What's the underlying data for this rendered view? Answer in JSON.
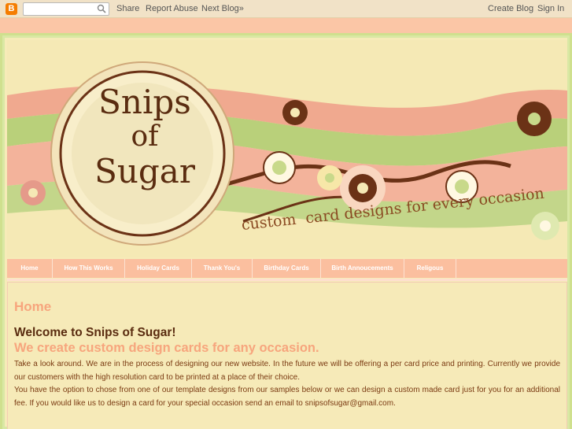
{
  "navbar": {
    "logo_letter": "B",
    "search_placeholder": "",
    "share": "Share",
    "report_abuse": "Report Abuse",
    "next_blog": "Next Blog»",
    "create_blog": "Create Blog",
    "sign_in": "Sign In"
  },
  "header": {
    "logo_line1": "Snips",
    "logo_line2": "of",
    "logo_line3": "Sugar",
    "slogan": "custom  card designs for every occasion"
  },
  "menu": {
    "items": [
      {
        "label": "Home"
      },
      {
        "label": "How This Works"
      },
      {
        "label": "Holiday Cards"
      },
      {
        "label": "Thank You's"
      },
      {
        "label": "Birthday Cards"
      },
      {
        "label": "Birth Annoucements"
      },
      {
        "label": "Religous"
      }
    ]
  },
  "content": {
    "page_title": "Home",
    "welcome": "Welcome to Snips of Sugar!",
    "tagline": "We create custom design cards for any occasion.",
    "paragraph1": "Take a look around. We are in the process of designing our new website. In the future we will be offering a per card price and printing. Currently we provide our customers with the high resolution card to be printed at a place of their choice.",
    "paragraph2": "You have the option to chose from one of our template designs from our samples below or we can design a custom made card just for you for an additional fee. If you would like us to design a card for your special occasion send an email to snipsofsugar@gmail.com."
  },
  "colors": {
    "navbar_bg": "#f1e2c7",
    "accent_peach": "#fbbf9f",
    "title_peach": "#f7a57d",
    "brown": "#5a2c10",
    "green": "#b6cf6e",
    "cream": "#f6eab8"
  }
}
